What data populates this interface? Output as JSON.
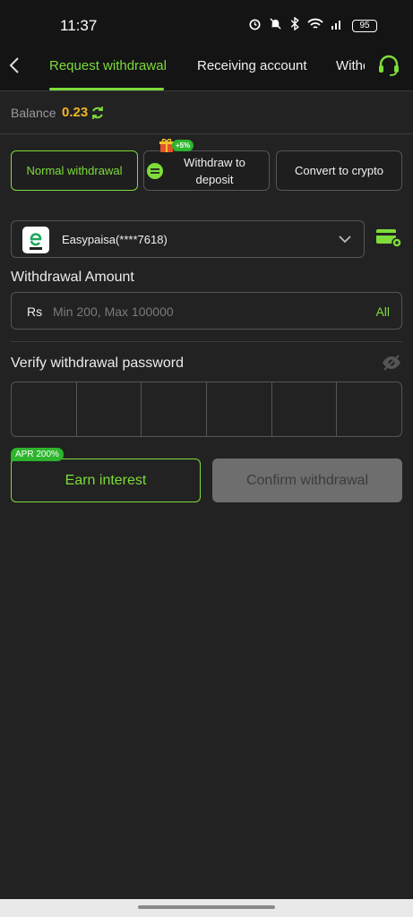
{
  "status_bar": {
    "time": "11:37",
    "battery": "95"
  },
  "nav": {
    "tabs": [
      {
        "label": "Request withdrawal",
        "active": true
      },
      {
        "label": "Receiving account",
        "active": false
      },
      {
        "label": "Withdraw",
        "active": false
      }
    ],
    "back_icon": "chevron-left-icon",
    "support_icon": "headset-icon"
  },
  "balance": {
    "label": "Balance",
    "value": "0.23"
  },
  "modes": {
    "normal": "Normal withdrawal",
    "deposit_line1": "Withdraw to",
    "deposit_line2": "deposit",
    "deposit_bonus": "+5%",
    "crypto": "Convert to crypto"
  },
  "account": {
    "name": "Easypaisa(****7618)",
    "logo_letter": "e"
  },
  "amount": {
    "label": "Withdrawal Amount",
    "currency": "Rs",
    "placeholder": "Min 200, Max 100000",
    "all_label": "All"
  },
  "password": {
    "label": "Verify withdrawal password",
    "digits": 6
  },
  "actions": {
    "earn_label": "Earn interest",
    "apr_badge": "APR 200%",
    "confirm_label": "Confirm withdrawal"
  },
  "colors": {
    "accent": "#7ddc3a",
    "balance": "#f0b528",
    "background": "#222222"
  }
}
